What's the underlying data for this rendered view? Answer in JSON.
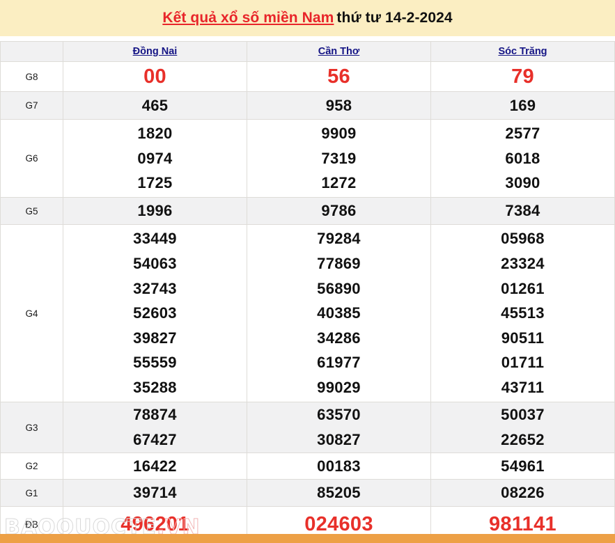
{
  "header": {
    "link_text": "Kết quả xổ số miền Nam",
    "date_text": "thứ tư 14-2-2024",
    "band_color": "#fbeec2",
    "link_color": "#e8252a"
  },
  "table": {
    "label_column_header": "",
    "provinces": [
      {
        "name": "Đồng Nai"
      },
      {
        "name": "Cần Thơ"
      },
      {
        "name": "Sóc Trăng"
      }
    ],
    "province_link_color": "#151585",
    "highlight_color": "#e8302a",
    "rows": [
      {
        "label": "G8",
        "stripe": "white",
        "highlight": true,
        "values": [
          [
            "00"
          ],
          [
            "56"
          ],
          [
            "79"
          ]
        ]
      },
      {
        "label": "G7",
        "stripe": "grey",
        "highlight": false,
        "values": [
          [
            "465"
          ],
          [
            "958"
          ],
          [
            "169"
          ]
        ]
      },
      {
        "label": "G6",
        "stripe": "white",
        "highlight": false,
        "values": [
          [
            "1820",
            "0974",
            "1725"
          ],
          [
            "9909",
            "7319",
            "1272"
          ],
          [
            "2577",
            "6018",
            "3090"
          ]
        ]
      },
      {
        "label": "G5",
        "stripe": "grey",
        "highlight": false,
        "values": [
          [
            "1996"
          ],
          [
            "9786"
          ],
          [
            "7384"
          ]
        ]
      },
      {
        "label": "G4",
        "stripe": "white",
        "highlight": false,
        "values": [
          [
            "33449",
            "54063",
            "32743",
            "52603",
            "39827",
            "55559",
            "35288"
          ],
          [
            "79284",
            "77869",
            "56890",
            "40385",
            "34286",
            "61977",
            "99029"
          ],
          [
            "05968",
            "23324",
            "01261",
            "45513",
            "90511",
            "01711",
            "43711"
          ]
        ]
      },
      {
        "label": "G3",
        "stripe": "grey",
        "highlight": false,
        "values": [
          [
            "78874",
            "67427"
          ],
          [
            "63570",
            "30827"
          ],
          [
            "50037",
            "22652"
          ]
        ]
      },
      {
        "label": "G2",
        "stripe": "white",
        "highlight": false,
        "values": [
          [
            "16422"
          ],
          [
            "00183"
          ],
          [
            "54961"
          ]
        ]
      },
      {
        "label": "G1",
        "stripe": "grey",
        "highlight": false,
        "values": [
          [
            "39714"
          ],
          [
            "85205"
          ],
          [
            "08226"
          ]
        ]
      },
      {
        "label": "ĐB",
        "stripe": "white",
        "highlight": true,
        "values": [
          [
            "496201"
          ],
          [
            "024603"
          ],
          [
            "981141"
          ]
        ]
      }
    ]
  },
  "watermark": {
    "text_main": "BAOQUOCTE",
    "text_suffix": ".VN"
  },
  "bottom_bar": {
    "left_text": "",
    "right_text": "",
    "color": "#eda046"
  }
}
